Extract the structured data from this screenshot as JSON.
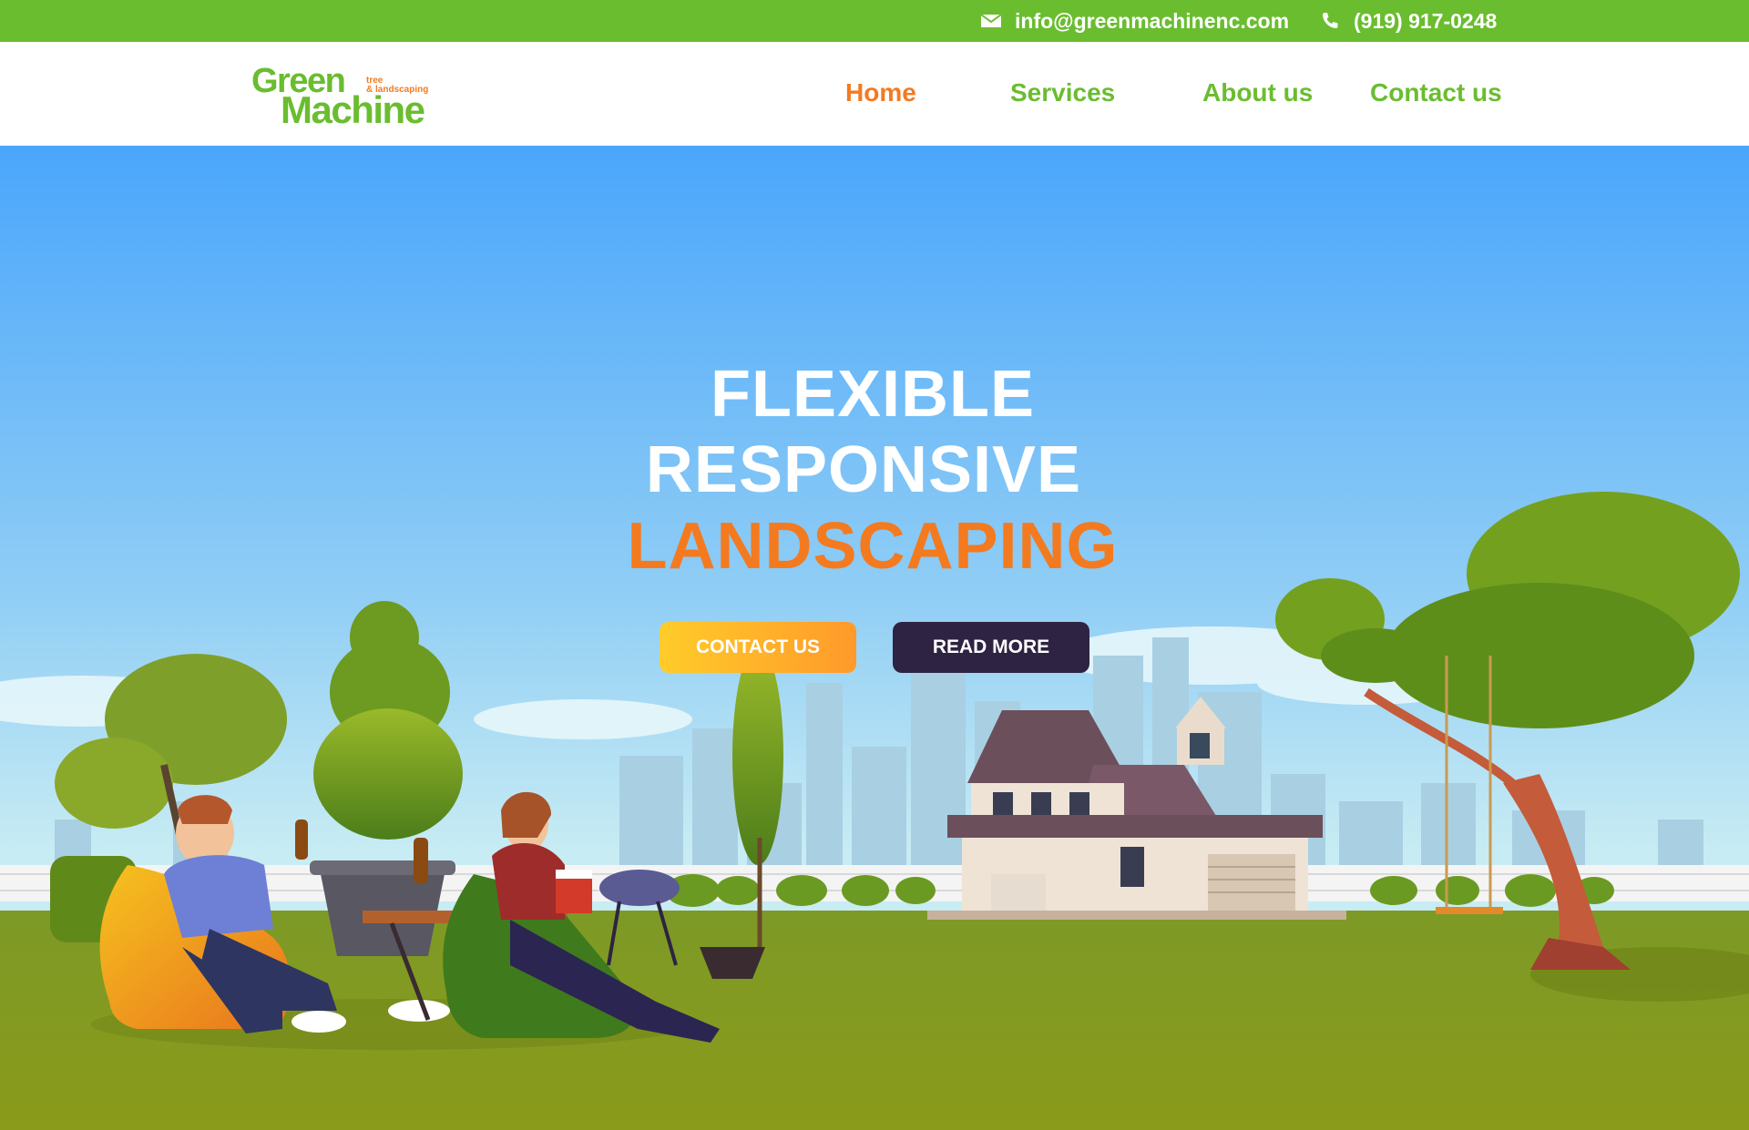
{
  "topbar": {
    "email": "info@greenmachinenc.com",
    "phone": "(919) 917-0248",
    "email_icon": "envelope-icon",
    "phone_icon": "phone-icon"
  },
  "logo": {
    "line1": "Green",
    "line2": "Machine",
    "tag1": "tree",
    "tag2": "& landscaping"
  },
  "nav": {
    "items": [
      {
        "label": "Home",
        "active": true
      },
      {
        "label": "Services",
        "active": false
      },
      {
        "label": "About us",
        "active": false
      },
      {
        "label": "Contact us",
        "active": false
      }
    ]
  },
  "hero": {
    "line1": "FLEXIBLE",
    "line2": "RESPONSIVE",
    "line3": "LANDSCAPING",
    "contact_button": "CONTACT US",
    "read_more_button": "READ MORE"
  },
  "colors": {
    "brand_green": "#6abd2f",
    "accent_orange": "#f47a1f",
    "dark_button": "#2e2342",
    "sky_top": "#4aa6fb",
    "grass": "#8a9a1e"
  }
}
